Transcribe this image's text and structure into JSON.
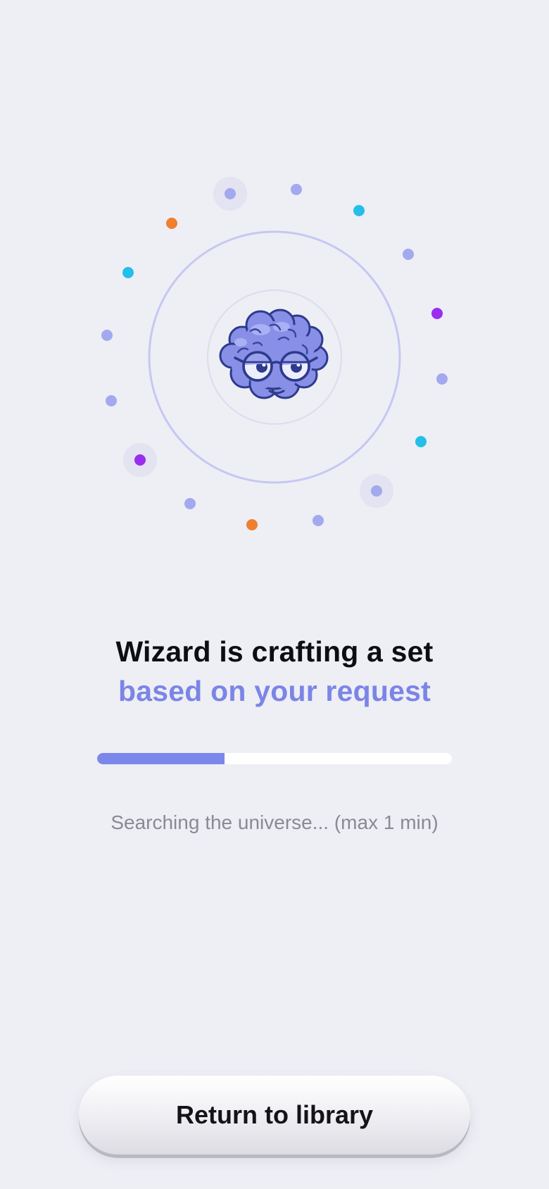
{
  "headline": {
    "line1": "Wizard is crafting a set",
    "line2": "based on your request"
  },
  "progress": {
    "fraction": 0.36
  },
  "status": {
    "text": "Searching the universe... (max 1 min)"
  },
  "actions": {
    "return_label": "Return to library"
  },
  "icons": {
    "mascot": "brain-with-glasses-icon"
  },
  "colors": {
    "background": "#eeeef5",
    "accent": "#7b85e6",
    "dot_lavender": "#a3a9ee",
    "dot_cyan": "#24bfe8",
    "dot_orange": "#ee8030",
    "dot_purple": "#9a2ef0"
  }
}
